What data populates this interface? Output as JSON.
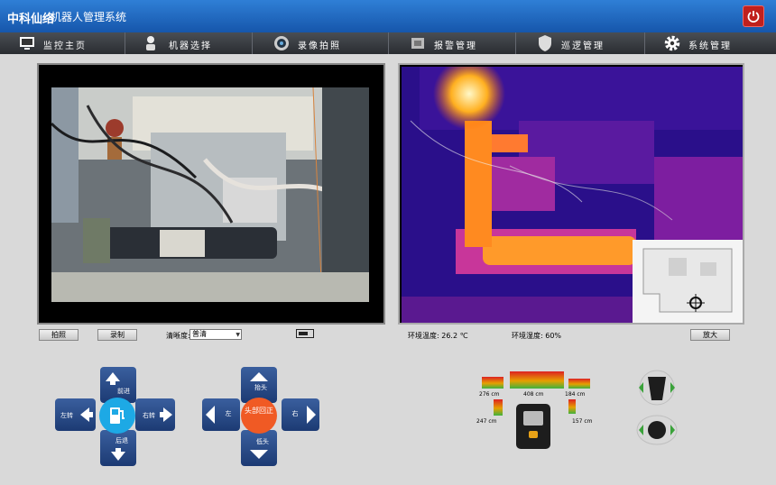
{
  "header": {
    "brand": "中科仙络",
    "title": "机器人管理系统"
  },
  "nav": [
    {
      "label": "监控主页",
      "icon": "monitor-icon"
    },
    {
      "label": "机器选择",
      "icon": "robot-icon"
    },
    {
      "label": "录像拍照",
      "icon": "camera-icon"
    },
    {
      "label": "报警管理",
      "icon": "alarm-icon"
    },
    {
      "label": "巡逻管理",
      "icon": "shield-icon"
    },
    {
      "label": "系统管理",
      "icon": "gear-icon"
    }
  ],
  "controls": {
    "capture_label": "拍照",
    "record_label": "录制",
    "clarity_label": "清晰度:",
    "clarity_value": "普清",
    "temperature": "环境温度: 26.2 ℃",
    "humidity": "环境湿度: 60%",
    "enlarge_label": "放大"
  },
  "move_pad": {
    "forward": "前进",
    "back": "后退",
    "left": "左转",
    "right": "右转"
  },
  "head_pad": {
    "up": "抬头",
    "down": "低头",
    "left": "左",
    "right": "右",
    "center": "头部回正"
  },
  "sensors": {
    "left_top": "276 cm",
    "center_top": "408 cm",
    "right_top": "184 cm",
    "left_bottom": "247 cm",
    "right_bottom": "157 cm"
  },
  "colors": {
    "accent": "#1656ab",
    "nav": "#2a2d31",
    "power": "#c0201d"
  }
}
